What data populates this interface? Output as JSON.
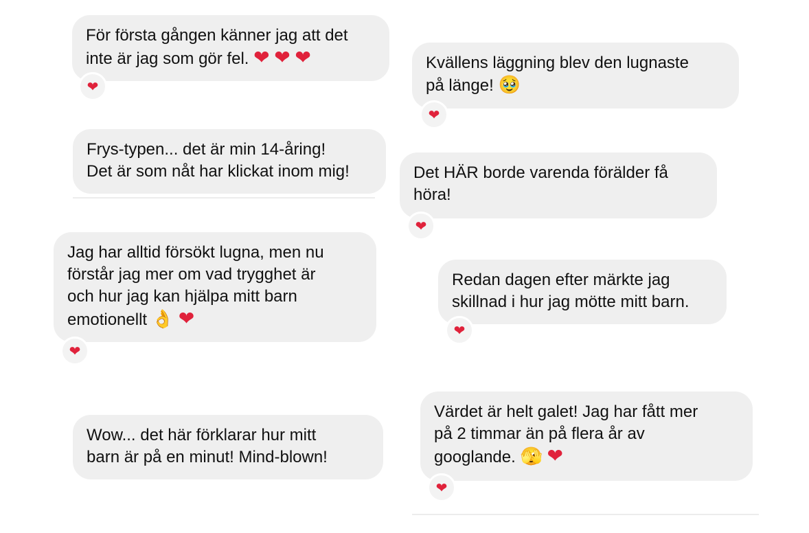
{
  "messages": [
    {
      "lines": [
        "För första gången känner jag att det",
        "inte är jag som gör fel."
      ],
      "inline_emoji": [
        "❤",
        "❤",
        "❤"
      ],
      "reaction": "❤"
    },
    {
      "lines": [
        "Kvällens läggning blev den lugnaste",
        "på länge!"
      ],
      "inline_emoji": [
        "🥹"
      ],
      "reaction": "❤"
    },
    {
      "lines": [
        "Frys-typen... det är min 14-åring!",
        "Det är som nåt har klickat inom mig!"
      ],
      "inline_emoji": [],
      "reaction": ""
    },
    {
      "lines": [
        "Det HÄR borde varenda förälder få",
        "höra!"
      ],
      "inline_emoji": [],
      "reaction": "❤"
    },
    {
      "lines": [
        "Jag har alltid försökt lugna, men nu",
        "förstår jag mer om vad trygghet är",
        "och hur jag kan hjälpa mitt barn",
        "emotionellt"
      ],
      "inline_emoji": [
        "👌",
        "❤"
      ],
      "reaction": "❤"
    },
    {
      "lines": [
        "Redan dagen efter märkte jag",
        "skillnad i hur jag mötte mitt barn."
      ],
      "inline_emoji": [],
      "reaction": "❤"
    },
    {
      "lines": [
        "Wow... det här förklarar hur mitt",
        "barn är på en minut! Mind-blown!"
      ],
      "inline_emoji": [],
      "reaction": ""
    },
    {
      "lines": [
        "Värdet är helt galet! Jag har fått mer",
        "på 2 timmar än på flera år av",
        "googlande."
      ],
      "inline_emoji": [
        "🫣",
        "❤"
      ],
      "reaction": "❤"
    }
  ],
  "colors": {
    "bubble_bg": "#efefef",
    "heart": "#e0223b",
    "text": "#111111"
  }
}
